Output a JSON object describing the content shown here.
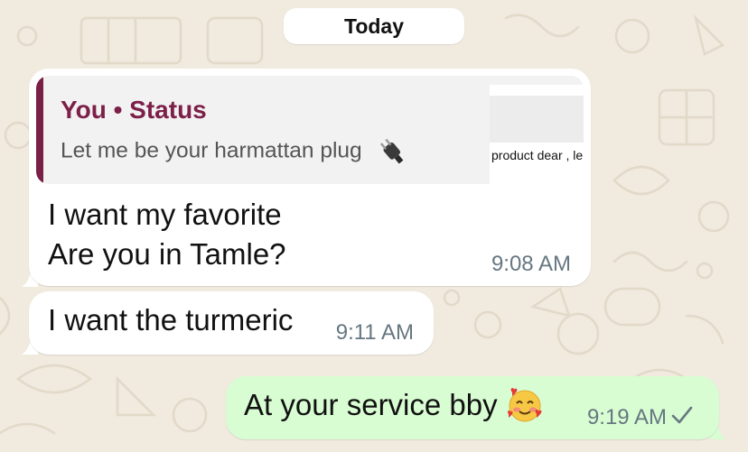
{
  "date_separator": "Today",
  "messages": [
    {
      "direction": "incoming",
      "reply_to": {
        "author": "You • Status",
        "text": "Let me be your harmattan plug",
        "thumbnail_caption": "product dear , le"
      },
      "lines": [
        "I want my favorite",
        "Are you in Tamle?"
      ],
      "time": "9:08 AM"
    },
    {
      "direction": "incoming",
      "text": "I want the turmeric",
      "time": "9:11 AM"
    },
    {
      "direction": "outgoing",
      "text": "At your service bby",
      "time": "9:19 AM",
      "status": "sent"
    }
  ],
  "colors": {
    "wallpaper": "#f0eadf",
    "incoming_bubble": "#ffffff",
    "outgoing_bubble": "#d9fdd3",
    "quote_accent": "#7a1f45",
    "timestamp": "#667781"
  },
  "icons": [
    "plug-icon",
    "smiling-face-with-hearts-emoji",
    "single-check-icon"
  ]
}
